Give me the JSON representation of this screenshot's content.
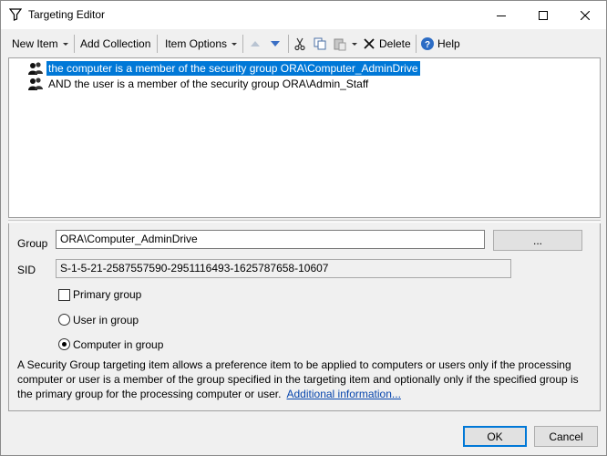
{
  "window": {
    "title": "Targeting Editor"
  },
  "toolbar": {
    "new_item": "New Item",
    "add_collection": "Add Collection",
    "item_options": "Item Options",
    "delete": "Delete",
    "help": "Help"
  },
  "tree": {
    "items": [
      {
        "label": "the computer is a member of the security group ORA\\Computer_AdminDrive",
        "selected": true,
        "icon": "security-group-icon"
      },
      {
        "label": "AND the user is a member of the security group ORA\\Admin_Staff",
        "selected": false,
        "icon": "security-group-icon"
      }
    ]
  },
  "properties": {
    "group_label": "Group",
    "group_value": "ORA\\Computer_AdminDrive",
    "browse_label": "...",
    "sid_label": "SID",
    "sid_value": "S-1-5-21-2587557590-2951116493-1625787658-10607",
    "primary_group_label": "Primary group",
    "user_in_group_label": "User in group",
    "computer_in_group_label": "Computer in group",
    "description": "A Security Group targeting item allows a preference item to be applied to computers or users only if the processing computer or user is a member of the group specified in the targeting item and optionally only if the specified group is the primary group for the processing computer or user.",
    "link_text": "Additional information..."
  },
  "footer": {
    "ok": "OK",
    "cancel": "Cancel"
  },
  "colors": {
    "selection": "#0078d7",
    "link": "#0645ad"
  }
}
